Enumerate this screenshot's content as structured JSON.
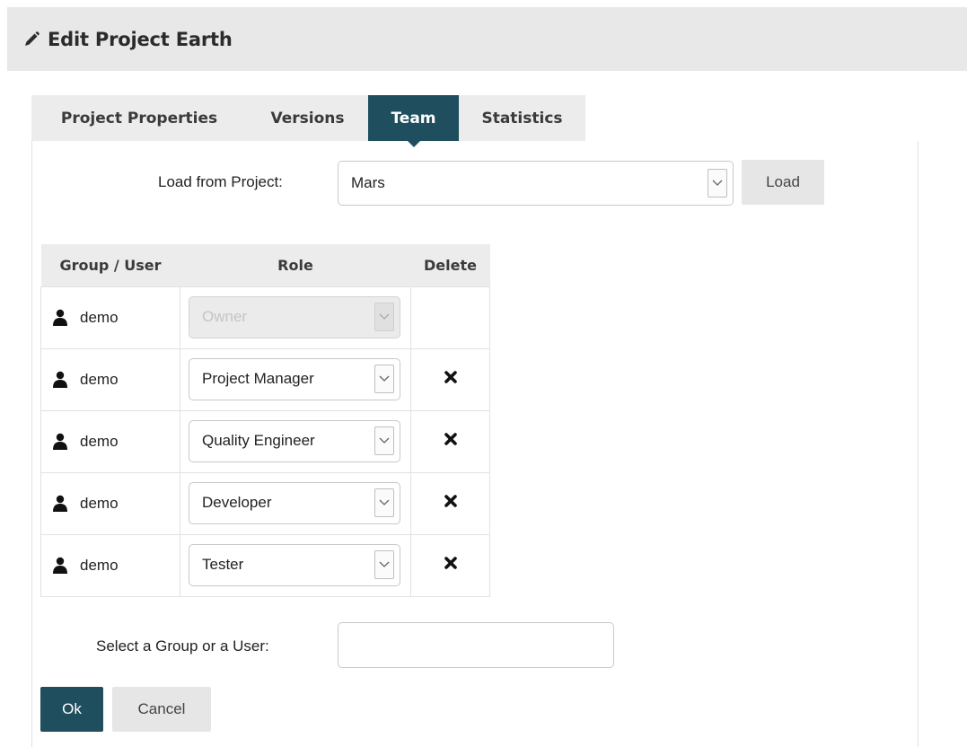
{
  "header": {
    "title": "Edit Project Earth",
    "icon": "pencil-icon"
  },
  "tabs": [
    {
      "label": "Project Properties",
      "active": false
    },
    {
      "label": "Versions",
      "active": false
    },
    {
      "label": "Team",
      "active": true
    },
    {
      "label": "Statistics",
      "active": false
    }
  ],
  "load_from_project": {
    "label": "Load from Project:",
    "selected": "Mars",
    "button_label": "Load"
  },
  "team_table": {
    "columns": [
      "Group / User",
      "Role",
      "Delete"
    ],
    "rows": [
      {
        "user": "demo",
        "role": "Owner",
        "disabled": true,
        "deletable": false
      },
      {
        "user": "demo",
        "role": "Project Manager",
        "disabled": false,
        "deletable": true
      },
      {
        "user": "demo",
        "role": "Quality Engineer",
        "disabled": false,
        "deletable": true
      },
      {
        "user": "demo",
        "role": "Developer",
        "disabled": false,
        "deletable": true
      },
      {
        "user": "demo",
        "role": "Tester",
        "disabled": false,
        "deletable": true
      }
    ]
  },
  "add_member": {
    "label": "Select a Group or a User:",
    "value": "",
    "placeholder": ""
  },
  "actions": {
    "ok_label": "Ok",
    "cancel_label": "Cancel"
  },
  "colors": {
    "accent": "#1f4f5e",
    "header_bg": "#e8e8e8",
    "tab_bg": "#ececec"
  }
}
